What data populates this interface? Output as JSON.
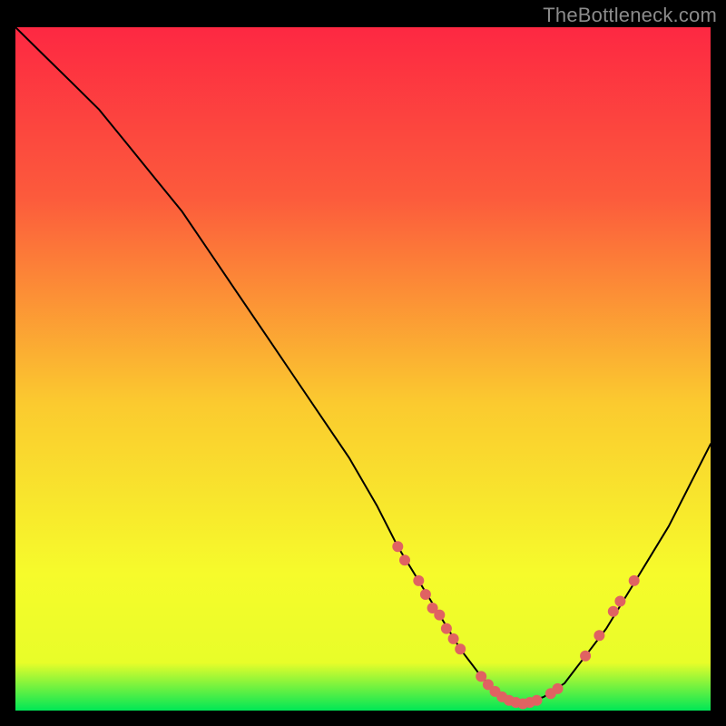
{
  "watermark": "TheBottleneck.com",
  "colors": {
    "bgTop": "#fd2842",
    "bgUpper": "#fc5b3c",
    "bgMid": "#fbca2f",
    "bgLower": "#f6fb2b",
    "bgBase": "#e8fd29",
    "bgBottom": "#00e756",
    "curve": "#000000",
    "marker": "#e06262",
    "frame": "#000000"
  },
  "chart_data": {
    "type": "line",
    "title": "",
    "xlabel": "",
    "ylabel": "",
    "xlim": [
      0,
      100
    ],
    "ylim": [
      0,
      100
    ],
    "x": [
      0,
      4,
      8,
      12,
      16,
      20,
      24,
      28,
      32,
      36,
      40,
      44,
      48,
      52,
      55,
      58,
      61,
      64,
      67,
      70,
      73,
      76,
      79,
      82,
      85,
      88,
      91,
      94,
      97,
      100
    ],
    "values": [
      100,
      96,
      92,
      88,
      83,
      78,
      73,
      67,
      61,
      55,
      49,
      43,
      37,
      30,
      24,
      19,
      14,
      9,
      5,
      2,
      1,
      2,
      4,
      8,
      12,
      17,
      22,
      27,
      33,
      39
    ],
    "markers": [
      {
        "x": 55,
        "y": 24
      },
      {
        "x": 56,
        "y": 22
      },
      {
        "x": 58,
        "y": 19
      },
      {
        "x": 59,
        "y": 17
      },
      {
        "x": 60,
        "y": 15
      },
      {
        "x": 61,
        "y": 14
      },
      {
        "x": 62,
        "y": 12
      },
      {
        "x": 63,
        "y": 10.5
      },
      {
        "x": 64,
        "y": 9
      },
      {
        "x": 67,
        "y": 5
      },
      {
        "x": 68,
        "y": 3.8
      },
      {
        "x": 69,
        "y": 2.8
      },
      {
        "x": 70,
        "y": 2
      },
      {
        "x": 71,
        "y": 1.5
      },
      {
        "x": 72,
        "y": 1.2
      },
      {
        "x": 73,
        "y": 1
      },
      {
        "x": 74,
        "y": 1.2
      },
      {
        "x": 75,
        "y": 1.5
      },
      {
        "x": 77,
        "y": 2.5
      },
      {
        "x": 78,
        "y": 3.2
      },
      {
        "x": 82,
        "y": 8
      },
      {
        "x": 84,
        "y": 11
      },
      {
        "x": 86,
        "y": 14.5
      },
      {
        "x": 87,
        "y": 16
      },
      {
        "x": 89,
        "y": 19
      }
    ],
    "gradient_stops": [
      {
        "offset": 0.0,
        "key": "bgTop"
      },
      {
        "offset": 0.25,
        "key": "bgUpper"
      },
      {
        "offset": 0.55,
        "key": "bgMid"
      },
      {
        "offset": 0.8,
        "key": "bgLower"
      },
      {
        "offset": 0.93,
        "key": "bgBase"
      },
      {
        "offset": 1.0,
        "key": "bgBottom"
      }
    ]
  }
}
